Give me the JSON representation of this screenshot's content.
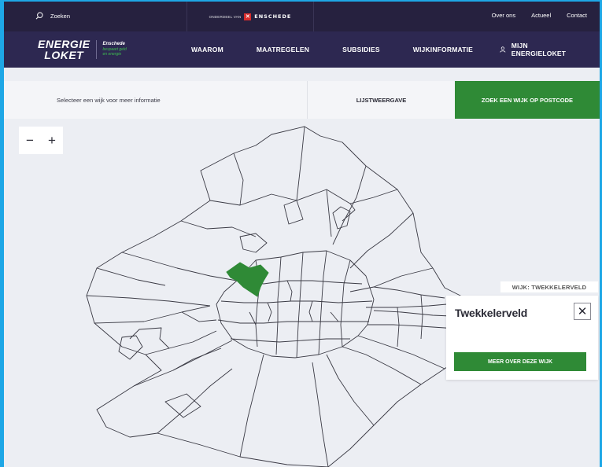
{
  "topbar": {
    "search_label": "Zoeken",
    "partner_prefix": "ONDERDEEL VAN",
    "partner_name": "ENSCHEDE",
    "links": [
      "Over ons",
      "Actueel",
      "Contact"
    ]
  },
  "logo": {
    "line1": "ENERGIE",
    "line2": "LOKET",
    "city": "Enschede",
    "tag1": "bespaart geld",
    "tag2": "en energie"
  },
  "nav": {
    "items": [
      "WAAROM",
      "MAATREGELEN",
      "SUBSIDIES",
      "WIJKINFORMATIE"
    ],
    "account": "MIJN ENERGIELOKET"
  },
  "subbar": {
    "hint": "Selecteer een wijk voor meer informatie",
    "list_view": "LIJSTWEERGAVE",
    "postcode_button": "ZOEK EEN WIJK OP POSTCODE"
  },
  "map": {
    "zoom_out": "−",
    "zoom_in": "+",
    "selected_label": "WIJK: TWEKKELERVELD",
    "popup_title": "Twekkelerveld",
    "popup_close": "✕",
    "popup_button": "MEER OVER DEZE WIJK",
    "highlight_color": "#2f8a36"
  },
  "colors": {
    "topbar_bg": "#26213f",
    "nav_bg": "#2d2851",
    "accent_green": "#2f8a36",
    "frame_blue": "#1ea7e6"
  }
}
